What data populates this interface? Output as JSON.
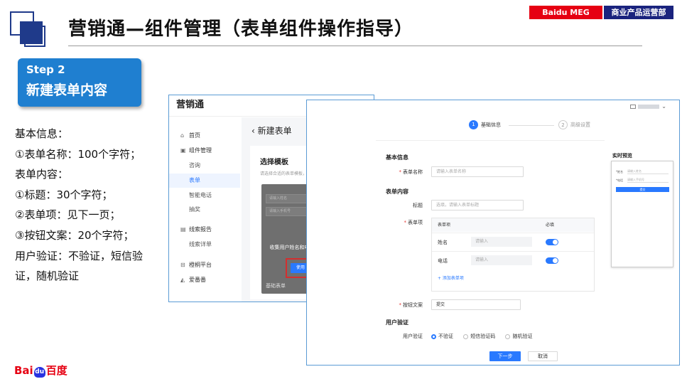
{
  "header": {
    "title": "营销通—组件管理（表单组件操作指导）",
    "badge_left": "Baidu MEG",
    "badge_right": "商业产品运营部"
  },
  "step": {
    "number": "Step 2",
    "name": "新建表单内容"
  },
  "info_lines": [
    "基本信息：",
    "①表单名称：100个字符；",
    "表单内容：",
    "①标题：30个字符；",
    "②表单项：见下一页；",
    "③按钮文案：20个字符；",
    "用户验证：不验证，短信验",
    "证，随机验证"
  ],
  "footer": {
    "logo_left": "Bai",
    "logo_paw": "du",
    "logo_right": "百度"
  },
  "app1": {
    "brand": "营销通",
    "sidebar": [
      {
        "label": "首页",
        "icon": "home-icon",
        "glyph": "⌂"
      },
      {
        "label": "组件管理",
        "icon": "component-icon",
        "glyph": "▣"
      },
      {
        "label": "咨询",
        "sub": true
      },
      {
        "label": "表单",
        "sub": true,
        "active": true
      },
      {
        "label": "智能电话",
        "sub": true
      },
      {
        "label": "抽奖",
        "sub": true
      },
      {
        "label": "线索报告",
        "icon": "report-icon",
        "glyph": "▤"
      },
      {
        "label": "线索详单",
        "sub": true
      },
      {
        "label": "橙桐平台",
        "icon": "platform-icon",
        "glyph": "⊟"
      },
      {
        "label": "爱番番",
        "icon": "aifanfan-icon",
        "glyph": "◭"
      }
    ],
    "crumb": "‹ 新建表单",
    "card_title": "选择模板",
    "card_hint": "请选择合适的表单模板，点击\"使用\"即可进入编辑表单页面",
    "template": {
      "field1": "请输入姓名",
      "field2": "请输入手机号",
      "name": "收集用户姓名和电话信息",
      "use_button": "使用",
      "bottom_label": "基础表单"
    }
  },
  "app2": {
    "steps": [
      {
        "no": "1",
        "label": "基础信息"
      },
      {
        "no": "2",
        "label": "高级设置"
      }
    ],
    "section_basic": "基本信息",
    "form_name_label": "表单名称",
    "form_name_placeholder": "请输入表单名称",
    "section_content": "表单内容",
    "title_label": "标题",
    "title_placeholder": "选填，请输入表单标题",
    "items_label": "表单项",
    "table": {
      "col_item": "表单项",
      "col_required": "必填",
      "rows": [
        {
          "name": "姓名",
          "placeholder": "请输入"
        },
        {
          "name": "电话",
          "placeholder": "请输入"
        }
      ],
      "add_item": "+ 添加表单项"
    },
    "button_text_label": "按钮文案",
    "button_text_value": "提交",
    "section_verify": "用户验证",
    "verify_label": "用户验证",
    "verify_options": [
      "不验证",
      "短信验证码",
      "随机验证"
    ],
    "next_button": "下一步",
    "cancel_button": "取消",
    "preview_title": "实时预览",
    "preview": {
      "label1": "*姓名",
      "input1": "请输入姓名",
      "label2": "*电话",
      "input2": "请输入手机号",
      "button": "提交"
    }
  },
  "colors": {
    "step_blue": "#1f7fd0",
    "brand_red": "#e60012",
    "dept_navy": "#1a237e",
    "highlight_red": "#d32f2f",
    "primary_blue": "#2979ff"
  }
}
